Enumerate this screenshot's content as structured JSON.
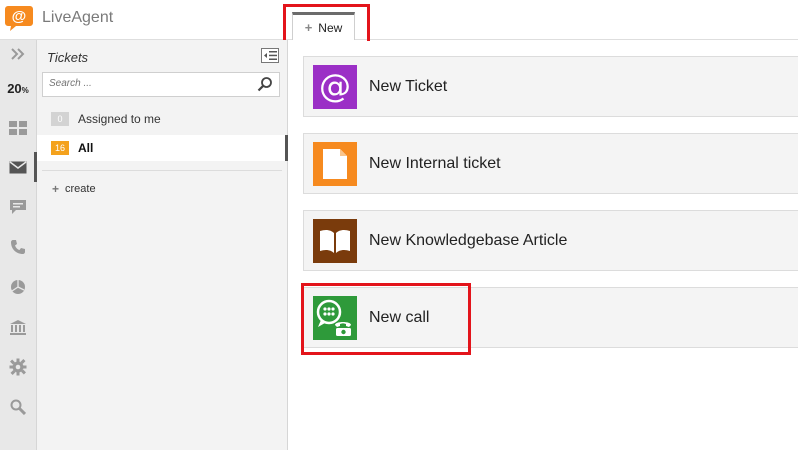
{
  "app": {
    "name": "LiveAgent"
  },
  "tabs": [
    {
      "label": "New"
    }
  ],
  "rail": {
    "percent": "20",
    "percent_unit": "%"
  },
  "panel": {
    "title": "Tickets",
    "search_placeholder": "Search ...",
    "filters": [
      {
        "count": "0",
        "label": "Assigned to me"
      },
      {
        "count": "16",
        "label": "All"
      }
    ],
    "create_label": "create"
  },
  "actions": [
    {
      "label": "New Ticket",
      "icon": "at-icon",
      "color": "#9b2fc6"
    },
    {
      "label": "New Internal ticket",
      "icon": "document-icon",
      "color": "#f68a1f"
    },
    {
      "label": "New Knowledgebase Article",
      "icon": "book-icon",
      "color": "#7a3b0c"
    },
    {
      "label": "New call",
      "icon": "phone-chat-icon",
      "color": "#2e9a3a"
    }
  ],
  "colors": {
    "accent": "#f68a1f",
    "highlight": "#e3141b",
    "rail_bg": "#e8e8e8"
  }
}
